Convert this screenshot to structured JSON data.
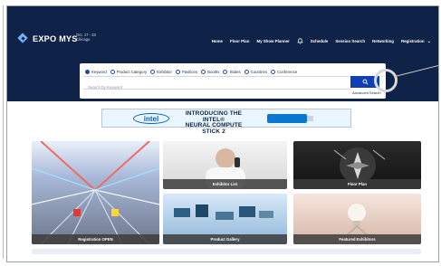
{
  "header": {
    "brand": "EXPO MYS",
    "event_date": "Oct. 17 - 23",
    "event_city": "Chicago",
    "nav": [
      "Home",
      "Floor Plan",
      "My Show Planner",
      "Schedule",
      "Session Search",
      "Networking",
      "Registration"
    ]
  },
  "search": {
    "filters": [
      {
        "label": "Keyword",
        "checked": true
      },
      {
        "label": "Product Category",
        "checked": false
      },
      {
        "label": "Exhibitor",
        "checked": false
      },
      {
        "label": "Pavilions",
        "checked": false
      },
      {
        "label": "Booths",
        "checked": false
      },
      {
        "label": "States",
        "checked": false
      },
      {
        "label": "Countries",
        "checked": false
      },
      {
        "label": "Conference",
        "checked": false
      }
    ],
    "placeholder": "Search by Keyword",
    "advanced_label": "Advanced Search"
  },
  "banner": {
    "brand": "intel",
    "headline_line1": "INTRODUCING THE INTEL®",
    "headline_line2": "NEURAL COMPUTE STICK 2"
  },
  "cards": [
    {
      "label": "Registration OPEN"
    },
    {
      "label": "Exhibitor List"
    },
    {
      "label": "Floor Plan"
    },
    {
      "label": "Product Gallery"
    },
    {
      "label": "Featured Exhibitors"
    }
  ],
  "icons": {
    "bell": "bell-icon",
    "search": "search-icon",
    "chevron": "chevron-down-icon"
  },
  "colors": {
    "header": "#0f2248",
    "search_button": "#0f3fb2",
    "radio": "#1f4ea2"
  }
}
